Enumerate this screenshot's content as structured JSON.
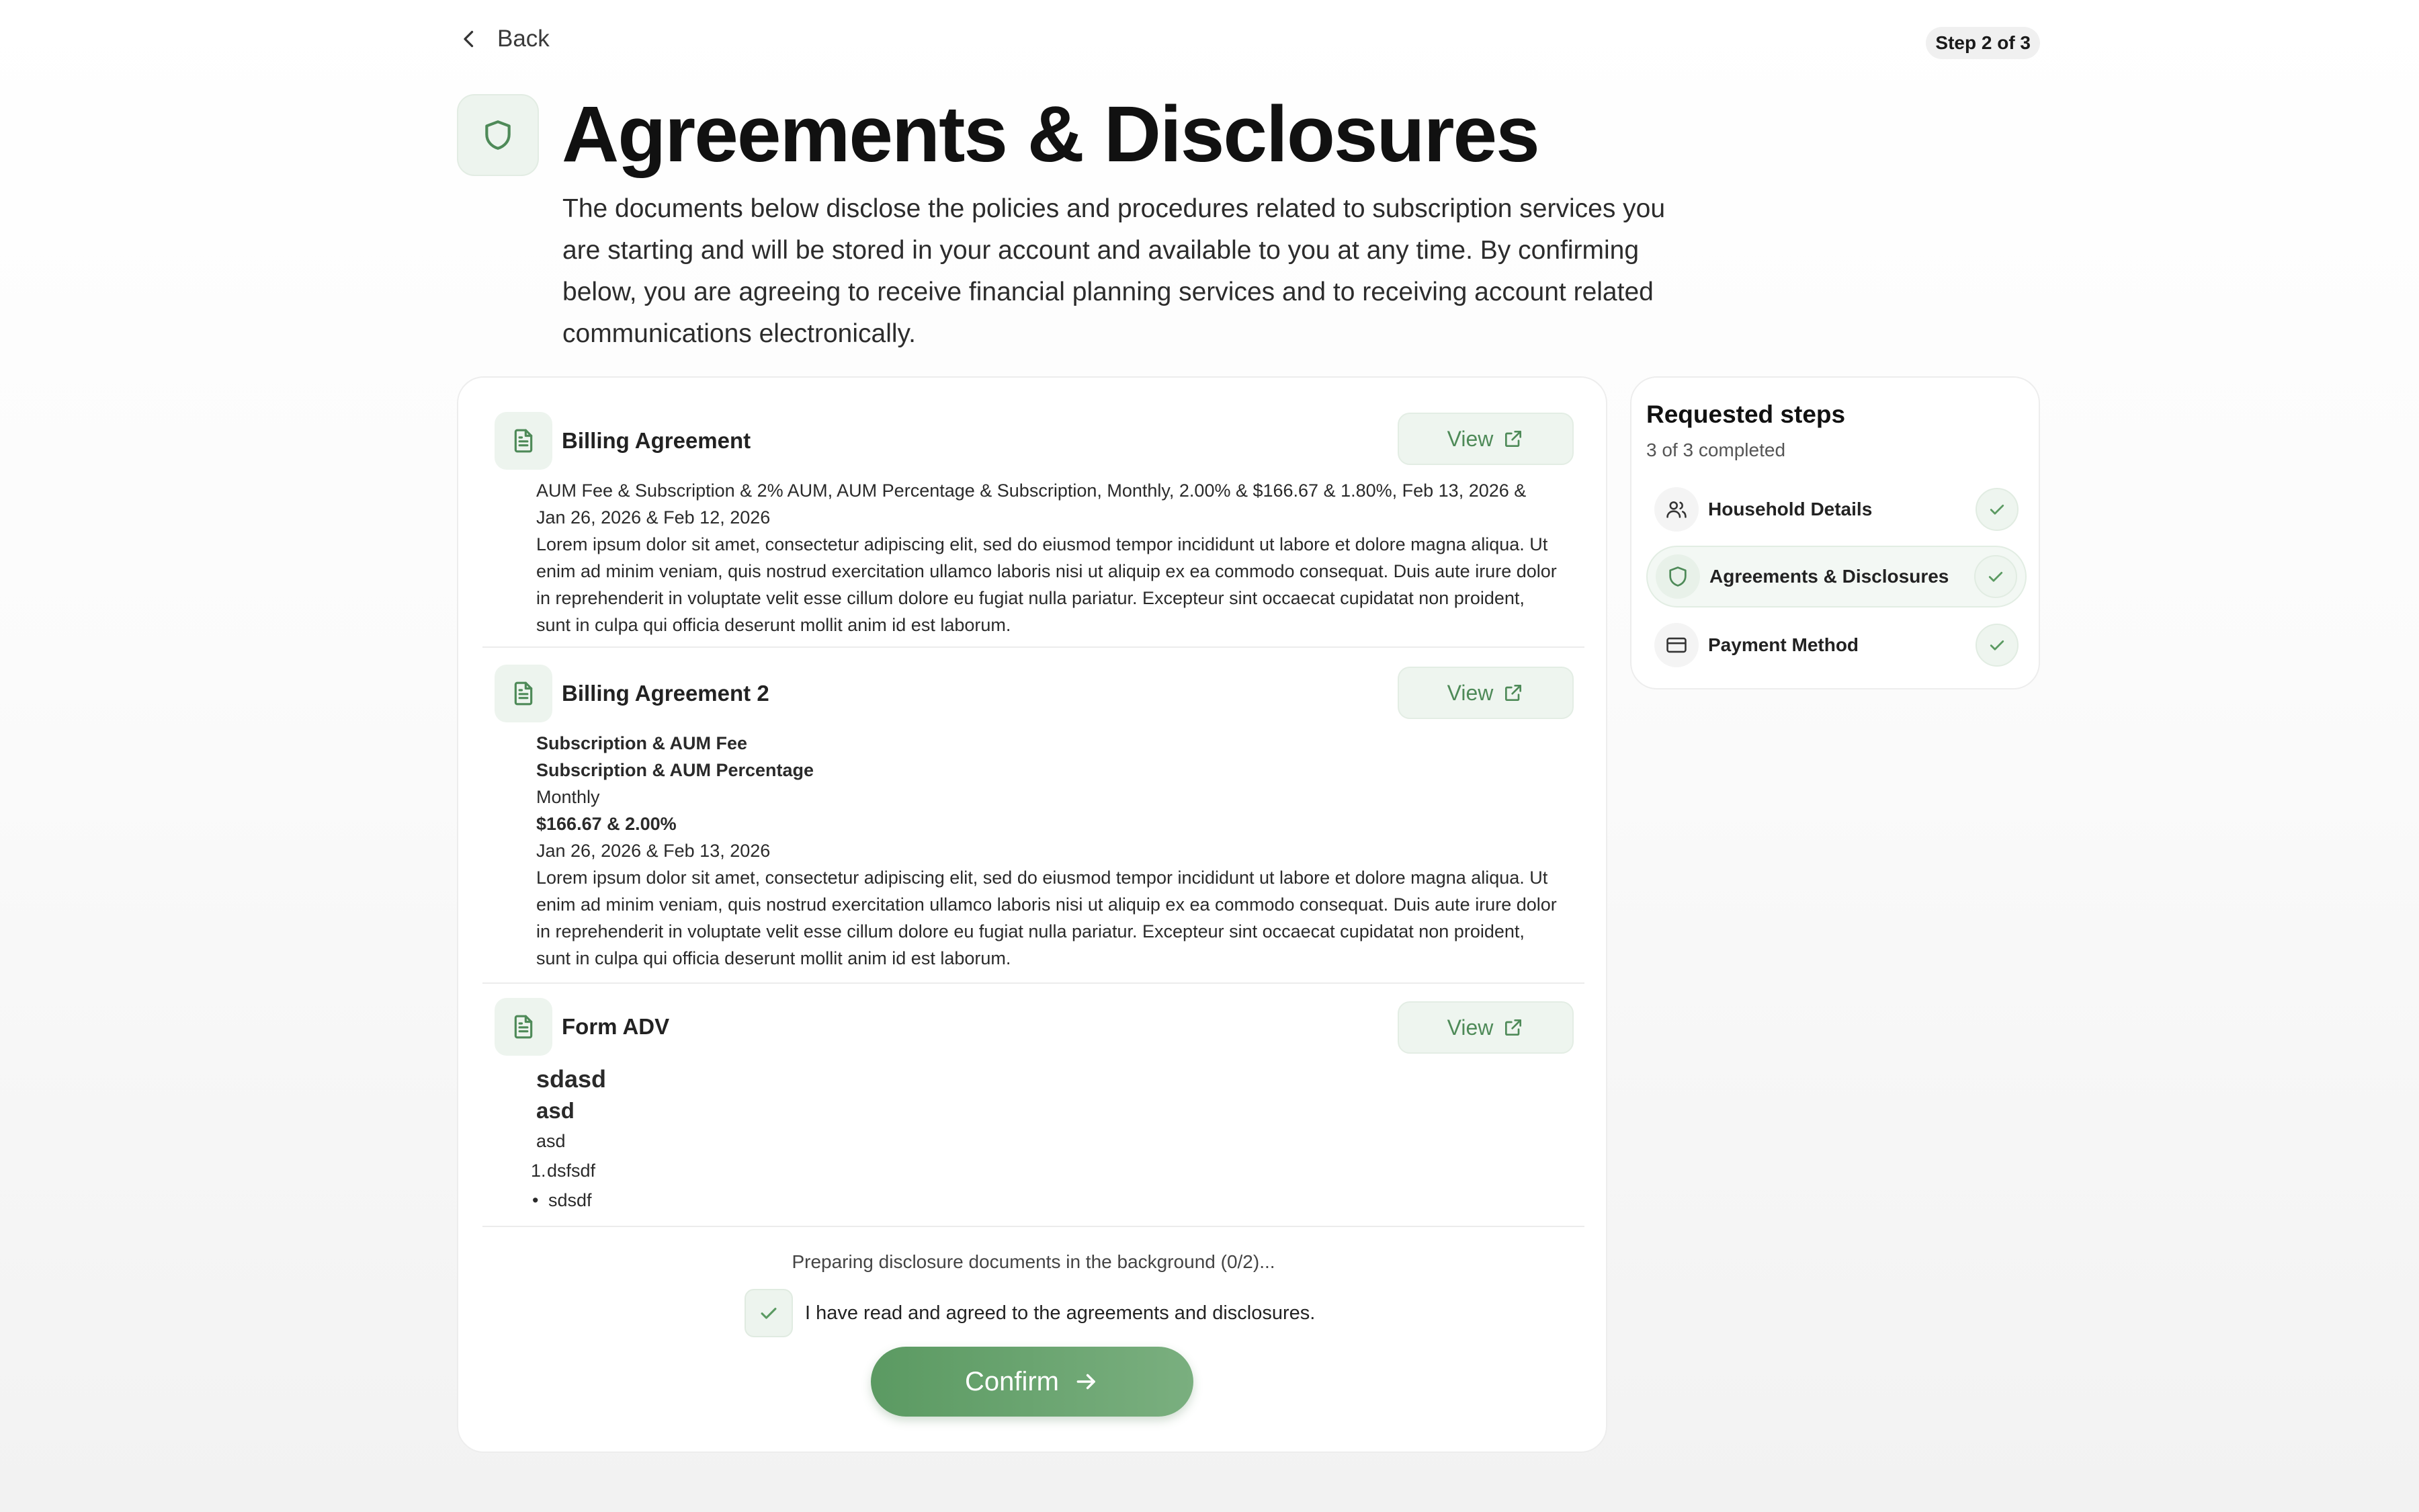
{
  "header": {
    "back_label": "Back",
    "step_indicator": "Step 2 of 3"
  },
  "page": {
    "title": "Agreements & Disclosures",
    "intro": "The documents below disclose the policies and procedures related to subscription services you are starting and will be stored in your account and available to you at any time. By confirming below, you are agreeing to receive financial planning services and to receiving account related communications electronically."
  },
  "documents": [
    {
      "title": "Billing Agreement",
      "view_label": "View",
      "summary": "AUM Fee & Subscription & 2% AUM, AUM Percentage & Subscription, Monthly, 2.00% & $166.67 & 1.80%, Feb 13, 2026 & Jan 26, 2026 & Feb 12, 2026",
      "body": "Lorem ipsum dolor sit amet, consectetur adipiscing elit, sed do eiusmod tempor incididunt ut labore et dolore magna aliqua. Ut enim ad minim veniam, quis nostrud exercitation ullamco laboris nisi ut aliquip ex ea commodo consequat. Duis aute irure dolor in reprehenderit in voluptate velit esse cillum dolore eu fugiat nulla pariatur. Excepteur sint occaecat cupidatat non proident, sunt in culpa qui officia deserunt mollit anim id est laborum."
    },
    {
      "title": "Billing Agreement 2",
      "view_label": "View",
      "fee_type": "Subscription & AUM Fee",
      "fee_method": "Subscription & AUM Percentage",
      "frequency": "Monthly",
      "amount": "$166.67 & 2.00%",
      "dates": "Jan 26, 2026 & Feb 13, 2026",
      "body": "Lorem ipsum dolor sit amet, consectetur adipiscing elit, sed do eiusmod tempor incididunt ut labore et dolore magna aliqua. Ut enim ad minim veniam, quis nostrud exercitation ullamco laboris nisi ut aliquip ex ea commodo consequat. Duis aute irure dolor in reprehenderit in voluptate velit esse cillum dolore eu fugiat nulla pariatur. Excepteur sint occaecat cupidatat non proident, sunt in culpa qui officia deserunt mollit anim id est laborum."
    },
    {
      "title": "Form ADV",
      "view_label": "View",
      "heading1": "sdasd",
      "heading2": "asd",
      "paragraph": "asd",
      "ordered_marker": "1.",
      "ordered_item": "dsfsdf",
      "bullet_marker": "•",
      "bullet_item": "sdsdf"
    }
  ],
  "footer": {
    "progress_text": "Preparing disclosure documents in the background (0/2)...",
    "agree_label": "I have read and agreed to the agreements and disclosures.",
    "agree_checked": true,
    "confirm_label": "Confirm"
  },
  "sidebar": {
    "title": "Requested steps",
    "subtitle": "3 of 3 completed",
    "steps": [
      {
        "label": "Household Details",
        "icon": "users-icon",
        "completed": true,
        "active": false
      },
      {
        "label": "Agreements & Disclosures",
        "icon": "shield-icon",
        "completed": true,
        "active": true
      },
      {
        "label": "Payment Method",
        "icon": "credit-card-icon",
        "completed": true,
        "active": false
      }
    ]
  },
  "colors": {
    "accent": "#5b9a62",
    "accent_light": "#edf4ee",
    "text": "#1a1a1a"
  }
}
